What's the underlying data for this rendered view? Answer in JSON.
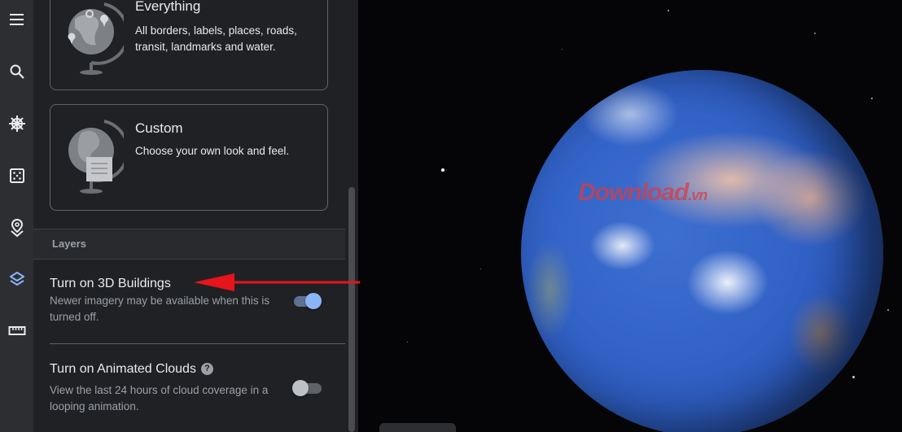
{
  "sidebar": {
    "items": [
      {
        "icon": "menu-icon",
        "active": false
      },
      {
        "icon": "search-icon",
        "active": false
      },
      {
        "icon": "voyager-ship-wheel-icon",
        "active": false
      },
      {
        "icon": "dice-feeling-lucky-icon",
        "active": false
      },
      {
        "icon": "projects-pin-icon",
        "active": false
      },
      {
        "icon": "layers-icon",
        "active": true
      },
      {
        "icon": "ruler-measure-icon",
        "active": false
      }
    ],
    "active_color": "#8ab4f8"
  },
  "map_styles": [
    {
      "title": "Everything",
      "description": "All borders, labels, places, roads, transit, landmarks and water."
    },
    {
      "title": "Custom",
      "description": "Choose your own look and feel."
    }
  ],
  "layers": {
    "header": "Layers",
    "settings": [
      {
        "title": "Turn on 3D Buildings",
        "description": "Newer imagery may be available when this is turned off.",
        "enabled": true,
        "help": false
      },
      {
        "title": "Turn on Animated Clouds",
        "description": "View the last 24 hours of cloud coverage in a looping animation.",
        "enabled": false,
        "help": true,
        "help_glyph": "?"
      }
    ]
  },
  "globe_view": {
    "watermark": "Download",
    "watermark_suffix": ".vn"
  },
  "colors": {
    "toggle_on_knob": "#8ab4f8",
    "toggle_on_track": "#5e7295",
    "toggle_off_knob": "#bdc1c6",
    "toggle_off_track": "#5f6368",
    "annotation_arrow": "#e8141b"
  }
}
